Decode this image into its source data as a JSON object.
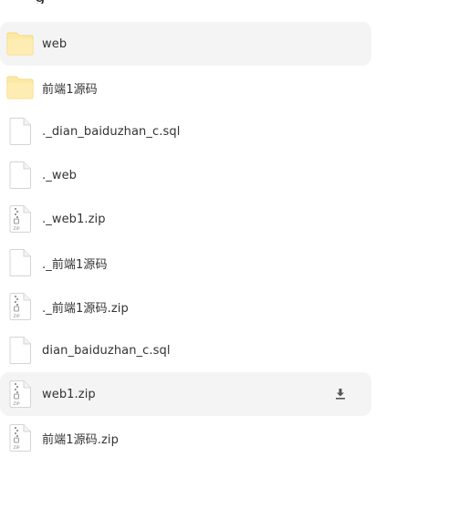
{
  "header": {
    "title_fragment": "g"
  },
  "files": [
    {
      "name": "web",
      "type": "folder",
      "highlighted": true
    },
    {
      "name": "前端1源码",
      "type": "folder"
    },
    {
      "name": "._dian_baiduzhan_c.sql",
      "type": "file"
    },
    {
      "name": "._web",
      "type": "file"
    },
    {
      "name": "._web1.zip",
      "type": "zip"
    },
    {
      "name": "._前端1源码",
      "type": "file"
    },
    {
      "name": "._前端1源码.zip",
      "type": "zip"
    },
    {
      "name": "dian_baiduzhan_c.sql",
      "type": "file"
    },
    {
      "name": "web1.zip",
      "type": "zip",
      "highlighted": true,
      "show_download": true
    },
    {
      "name": "前端1源码.zip",
      "type": "zip"
    }
  ],
  "icons": {
    "folder": "folder-icon",
    "file": "file-icon",
    "zip": "zip-file-icon",
    "download": "download-icon"
  },
  "zip_label": "ZIP",
  "colors": {
    "folder_fill": "#fde9a6",
    "folder_stroke": "#f5d97c",
    "row_highlight": "#f4f4f5",
    "text": "#333333",
    "icon_stroke": "#d4d4d4",
    "download_icon": "#555555"
  }
}
